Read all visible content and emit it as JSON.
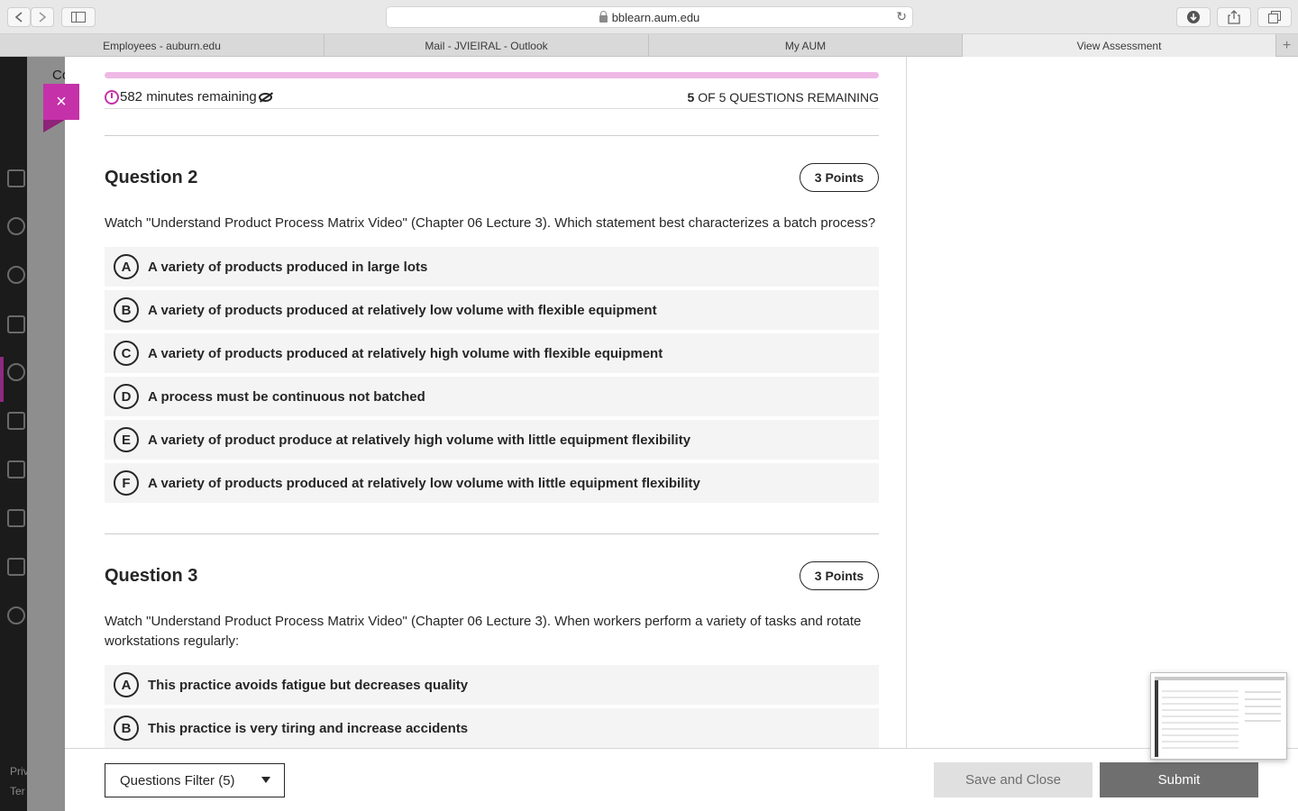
{
  "browser": {
    "url": "bblearn.aum.edu",
    "tabs": [
      {
        "label": "Employees - auburn.edu",
        "active": false
      },
      {
        "label": "Mail - JVIEIRAL - Outlook",
        "active": false
      },
      {
        "label": "My AUM",
        "active": false
      },
      {
        "label": "View Assessment",
        "active": true
      }
    ]
  },
  "background": {
    "course_prefix": "Co",
    "footer_lines": [
      "Priv",
      "Ter"
    ]
  },
  "assessment": {
    "close_label": "×",
    "progress_fraction": 1.0,
    "timer_text": "582 minutes remaining",
    "remaining_count": "5",
    "remaining_suffix": "OF 5 QUESTIONS REMAINING"
  },
  "questions": [
    {
      "title": "Question 2",
      "points": "3 Points",
      "text": "Watch \"Understand Product Process Matrix Video\" (Chapter 06 Lecture 3). Which statement best characterizes a batch process?",
      "options": [
        {
          "letter": "A",
          "text": "A variety of products produced in large lots"
        },
        {
          "letter": "B",
          "text": "A variety of products produced at relatively low volume with flexible equipment"
        },
        {
          "letter": "C",
          "text": "A variety of products produced at relatively high volume with flexible equipment"
        },
        {
          "letter": "D",
          "text": "A process must be continuous not batched"
        },
        {
          "letter": "E",
          "text": "A variety of product produce at relatively high volume with little equipment flexibility"
        },
        {
          "letter": "F",
          "text": "A variety of products produced at relatively low volume with little equipment flexibility"
        }
      ]
    },
    {
      "title": "Question 3",
      "points": "3 Points",
      "text": "Watch \"Understand Product Process Matrix Video\" (Chapter 06 Lecture 3). When workers perform a variety of tasks and rotate workstations regularly:",
      "options": [
        {
          "letter": "A",
          "text": "This practice avoids fatigue but decreases quality"
        },
        {
          "letter": "B",
          "text": "This practice is very tiring and increase accidents"
        }
      ]
    }
  ],
  "footer": {
    "filter_label": "Questions Filter (5)",
    "save_label": "Save and Close",
    "submit_label": "Submit"
  },
  "colors": {
    "accent": "#c531a9",
    "progress": "#efb9e6",
    "submit_bg": "#6f6f6f",
    "save_bg": "#e0e0e0"
  }
}
